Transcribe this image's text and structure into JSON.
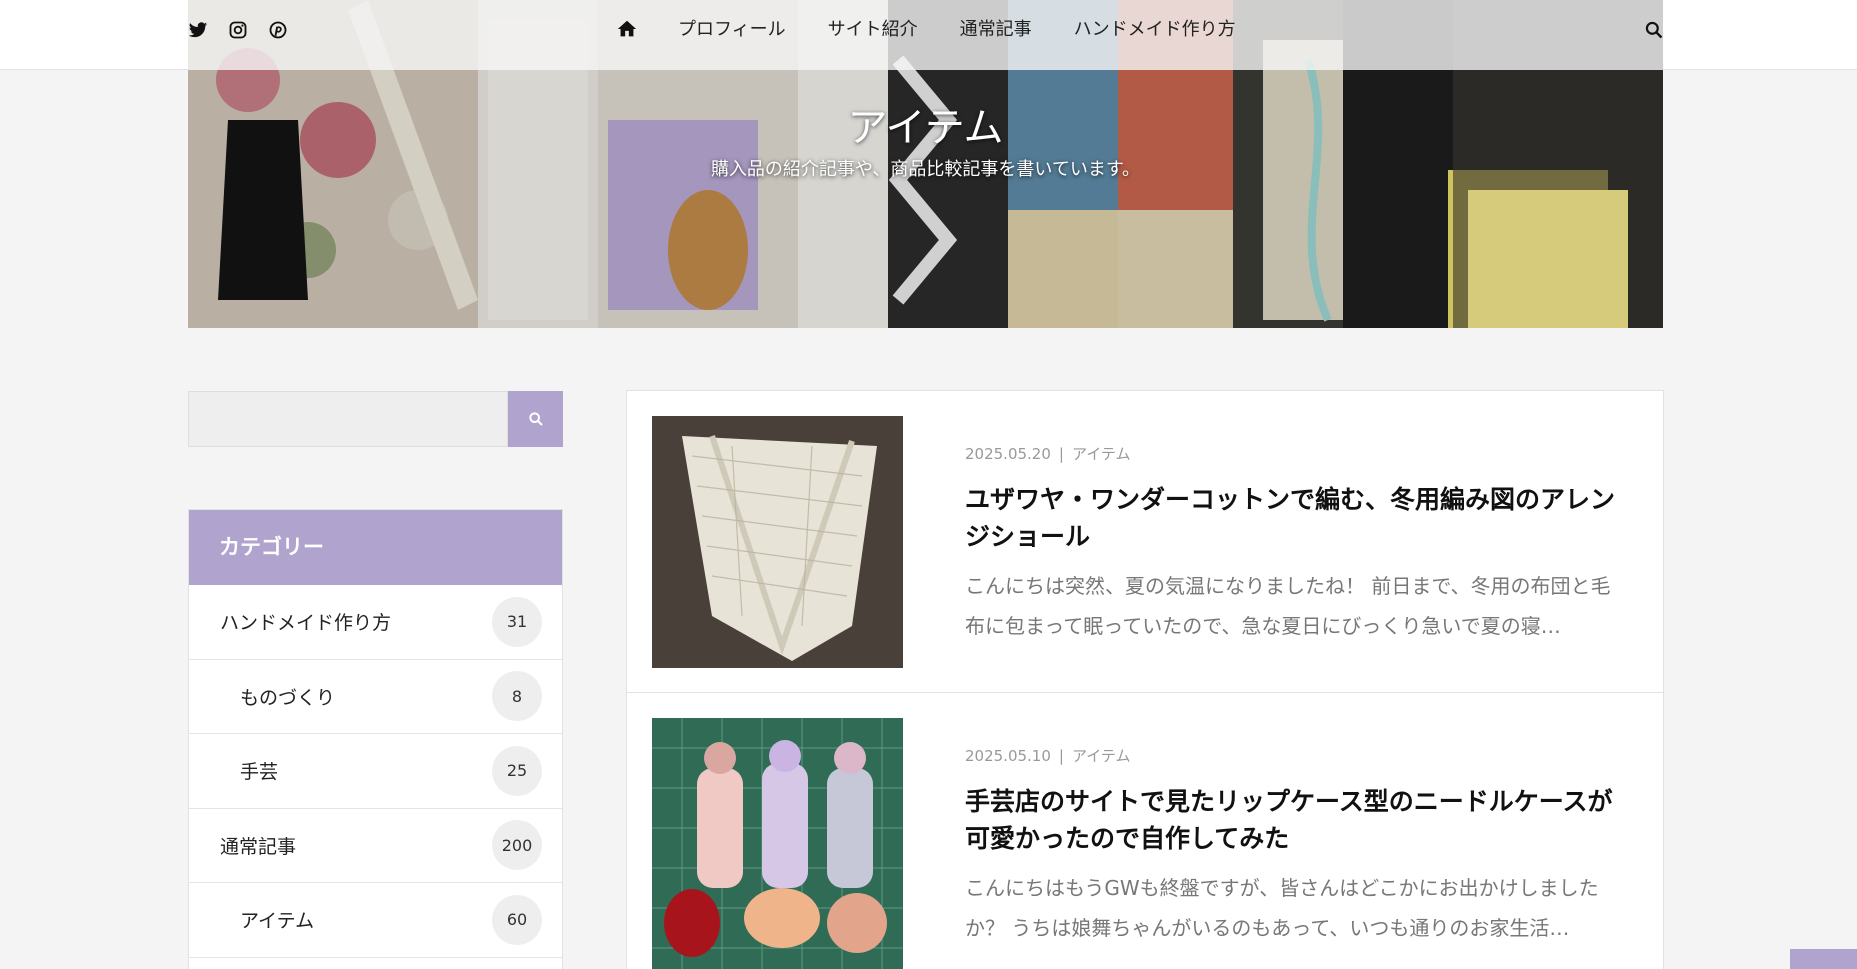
{
  "header": {
    "nav": [
      "プロフィール",
      "サイト紹介",
      "通常記事",
      "ハンドメイド作り方"
    ]
  },
  "hero": {
    "title": "アイテム",
    "subtitle": "購入品の紹介記事や、商品比較記事を書いています。"
  },
  "sidebar": {
    "search_placeholder": "",
    "category_heading": "カテゴリー",
    "categories": [
      {
        "name": "ハンドメイド作り方",
        "count": "31"
      },
      {
        "name": "ものづくり",
        "count": "8"
      },
      {
        "name": "手芸",
        "count": "25"
      },
      {
        "name": "通常記事",
        "count": "200"
      },
      {
        "name": "アイテム",
        "count": "60"
      }
    ]
  },
  "posts": [
    {
      "date": "2025.05.20",
      "category": "アイテム",
      "title": "ユザワヤ・ワンダーコットンで編む、冬用編み図のアレンジショール",
      "excerpt": "こんにちは突然、夏の気温になりましたね！ 前日まで、冬用の布団と毛布に包まって眠っていたので、急な夏日にびっくり急いで夏の寝…"
    },
    {
      "date": "2025.05.10",
      "category": "アイテム",
      "title": "手芸店のサイトで見たリップケース型のニードルケースが可愛かったので自作してみた",
      "excerpt": "こんにちはもうGWも終盤ですが、皆さんはどこかにお出かけしましたか？ うちは娘舞ちゃんがいるのもあって、いつも通りのお家生活…"
    }
  ],
  "colors": {
    "accent": "#b0a4cf",
    "background": "#f4f4f4"
  }
}
